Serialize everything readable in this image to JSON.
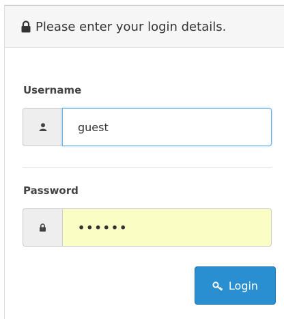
{
  "panel": {
    "heading": "Please enter your login details.",
    "heading_icon": "lock-icon"
  },
  "username": {
    "label": "Username",
    "value": "guest",
    "icon": "user-icon"
  },
  "password": {
    "label": "Password",
    "value": "••••••",
    "icon": "lock-icon"
  },
  "actions": {
    "login_label": "Login",
    "login_icon": "key-icon"
  },
  "colors": {
    "button_bg": "#2a8fd0",
    "focus_border": "#66afe9",
    "autofill_bg": "#fafdc4"
  }
}
